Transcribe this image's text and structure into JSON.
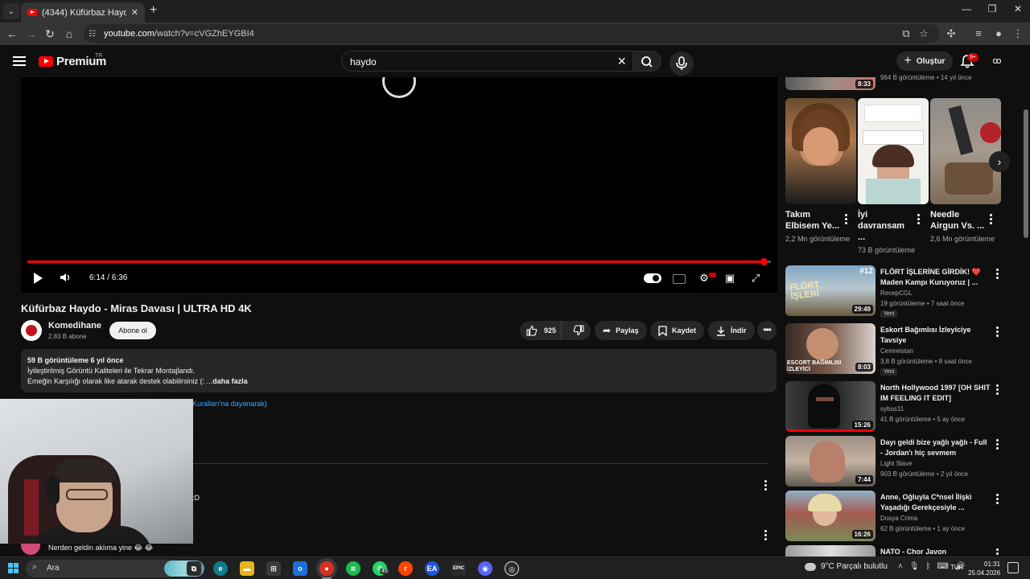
{
  "browser": {
    "tab_title": "(4344) Küfürbaz Haydo - Miras Dav",
    "url_host": "youtube.com",
    "url_path": "/watch?v=cVGZhEYGBI4"
  },
  "masthead": {
    "logo_text": "Premium",
    "country": "TR",
    "search_value": "haydo",
    "create_label": "Oluştur",
    "notif_count": "9+"
  },
  "player": {
    "time": "6:14 / 6:36",
    "progress": 0.9899,
    "accent": "#ff0000"
  },
  "video": {
    "title": "Küfürbaz Haydo - Miras Davası | ULTRA HD 4K",
    "channel": "Komedihane",
    "subscribers": "2,83 B abone",
    "subscribe_label": "Abone ol",
    "likes": "925",
    "share_label": "Paylaş",
    "save_label": "Kaydet",
    "download_label": "İndir"
  },
  "description": {
    "stats": "59 B görüntüleme  6 yıl önce",
    "line1": "İyileştirilmiş Görüntü Kaliteleri ile Tekrar Montajlandı.",
    "line2": "Emeğin Karşılığı olarak like atarak destek olabilirsiniz (: ...",
    "more_label": "daha fazla"
  },
  "comments": {
    "rules_link": "Kuralları'na dayanarak)",
    "comment1_fragment": ":D",
    "comment2_text": "Nerden geldin aklıma yine 😂 😂"
  },
  "sidebar": {
    "sliver": {
      "duration": "8:33",
      "meta": "964 B görüntüleme • 14 yıl önce"
    },
    "shorts": [
      {
        "title": "Takım Elbisem Ye...",
        "views": "2,2 Mn görüntüleme"
      },
      {
        "title": "İyi davransam ...",
        "views": "73 B görüntüleme"
      },
      {
        "title": "Needle Airgun Vs. ...",
        "views": "2,6 Mn görüntüleme"
      }
    ],
    "recommendations": [
      {
        "title": "FLÖRT İŞLERİNE GİRDİK! ❤️ Maden Kampı Kuruyoruz | ...",
        "channel": "RecepCGL",
        "meta": "19 görüntüleme • 7 saat önce",
        "badge": "Yeni",
        "duration": "29:49",
        "rank": "#12",
        "thumb_text": "FLÖRT İŞLERİ"
      },
      {
        "title": "Eskort Bağımlısı İzleyiciye Tavsiye",
        "channel": "Cemreistan",
        "meta": "3,8 B görüntüleme • 8 saat önce",
        "badge": "Yeni",
        "duration": "8:03",
        "thumb_text": "ESCORT BAĞIMLISI İZLEYİCİ"
      },
      {
        "title": "North Hollywood 1997  [OH SHIT IM FEELING IT EDIT]",
        "channel": "sybus11",
        "meta": "41 B görüntüleme • 5 ay önce",
        "duration": "15:26"
      },
      {
        "title": "Dayı geldi bize yağlı yağlı - Full - Jordan'ı hiç sevmem",
        "channel": "Light Slave",
        "meta": "903 B görüntüleme • 2 yıl önce",
        "duration": "7:44"
      },
      {
        "title": "Anne, Oğluyla C*nsel İlişki Yaşadığı Gerekçesiyle ...",
        "channel": "Dosya Crima",
        "meta": "62 B görüntüleme • 1 ay önce",
        "duration": "16:26"
      },
      {
        "title": "NATO - Chor Javon"
      }
    ]
  },
  "taskbar": {
    "search_placeholder": "Ara",
    "whatsapp_badge": "45",
    "weather": "9°C  Parçalı bulutlu",
    "lang": "TUR",
    "time": "01:31",
    "date": "25.04.2026"
  }
}
